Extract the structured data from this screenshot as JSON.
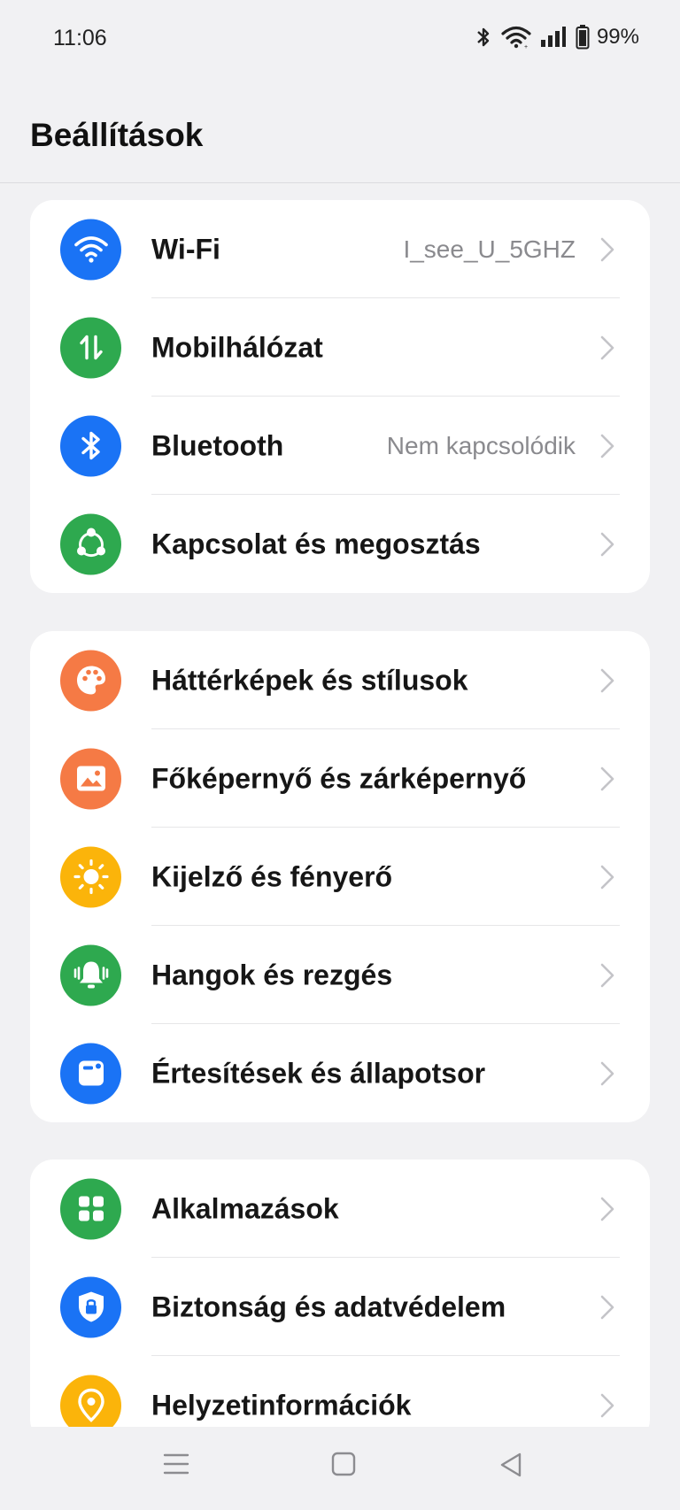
{
  "status_bar": {
    "time": "11:06",
    "battery": "99%",
    "icons": [
      "bluetooth-icon",
      "wifi-icon",
      "signal-icon",
      "battery-icon"
    ]
  },
  "header": {
    "title": "Beállítások"
  },
  "groups": [
    {
      "items": [
        {
          "label": "Wi-Fi",
          "value": "I_see_U_5GHZ",
          "icon": "wifi-icon",
          "color": "#1a73f5"
        },
        {
          "label": "Mobilhálózat",
          "value": "",
          "icon": "mobile-data-icon",
          "color": "#2ea94f"
        },
        {
          "label": "Bluetooth",
          "value": "Nem kapcsolódik",
          "icon": "bluetooth-icon",
          "color": "#1a73f5"
        },
        {
          "label": "Kapcsolat és megosztás",
          "value": "",
          "icon": "share-icon",
          "color": "#2ea94f"
        }
      ]
    },
    {
      "items": [
        {
          "label": "Háttérképek és stílusok",
          "value": "",
          "icon": "palette-icon",
          "color": "#f57a45"
        },
        {
          "label": "Főképernyő és zárképernyő",
          "value": "",
          "icon": "picture-icon",
          "color": "#f57a45"
        },
        {
          "label": "Kijelző és fényerő",
          "value": "",
          "icon": "sun-icon",
          "color": "#fbb40a"
        },
        {
          "label": "Hangok és rezgés",
          "value": "",
          "icon": "bell-icon",
          "color": "#2ea94f"
        },
        {
          "label": "Értesítések és állapotsor",
          "value": "",
          "icon": "notification-icon",
          "color": "#1a73f5"
        }
      ]
    },
    {
      "items": [
        {
          "label": "Alkalmazások",
          "value": "",
          "icon": "apps-grid-icon",
          "color": "#2ea94f"
        },
        {
          "label": "Biztonság és adatvédelem",
          "value": "",
          "icon": "shield-lock-icon",
          "color": "#1a73f5"
        },
        {
          "label": "Helyzetinformációk",
          "value": "",
          "icon": "location-pin-icon",
          "color": "#fbb40a"
        }
      ]
    }
  ],
  "nav_bar": {
    "buttons": [
      "menu-icon",
      "home-icon",
      "back-icon"
    ]
  }
}
